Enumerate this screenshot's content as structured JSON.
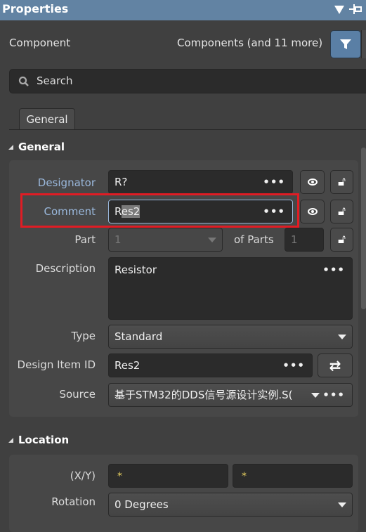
{
  "header": {
    "title": "Properties"
  },
  "selector": {
    "left_label": "Component",
    "filter_text": "Components (and 11 more)"
  },
  "search": {
    "placeholder": "Search"
  },
  "tabs": [
    {
      "label": "General"
    }
  ],
  "general": {
    "title": "General",
    "designator": {
      "label": "Designator",
      "value": "R?"
    },
    "comment": {
      "label": "Comment",
      "value_start": "R",
      "value_selected": "es2"
    },
    "part": {
      "label": "Part",
      "value": "1",
      "of_parts_label": "of Parts",
      "of_parts_value": "1"
    },
    "description": {
      "label": "Description",
      "value": "Resistor"
    },
    "type": {
      "label": "Type",
      "value": "Standard"
    },
    "design_item_id": {
      "label": "Design Item ID",
      "value": "Res2"
    },
    "source": {
      "label": "Source",
      "value": "基于STM32的DDS信号源设计实例.S("
    },
    "dots": "•••"
  },
  "location": {
    "title": "Location",
    "xy_label": "(X/Y)",
    "x": "*",
    "y": "*",
    "rotation_label": "Rotation",
    "rotation": "0 Degrees"
  },
  "colors": {
    "titlebar": "#6283a3",
    "highlight": "#e01c24",
    "accent": "#5a7fa5"
  }
}
